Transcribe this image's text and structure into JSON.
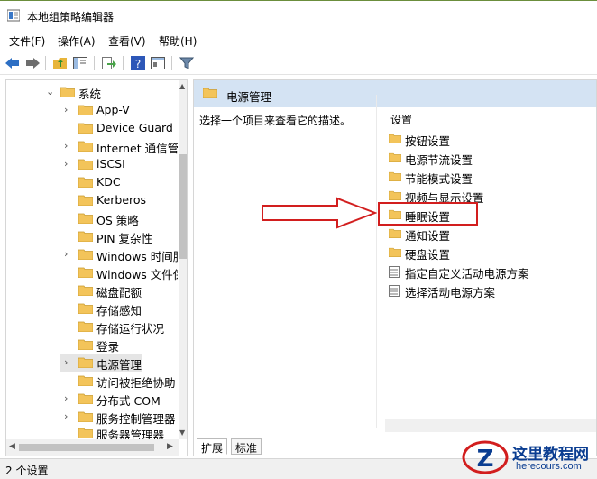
{
  "window": {
    "title": "本地组策略编辑器"
  },
  "menu": [
    "文件(F)",
    "操作(A)",
    "查看(V)",
    "帮助(H)"
  ],
  "toolbar": {
    "icons": [
      "back-icon",
      "forward-icon",
      "up-folder-icon",
      "show-hide-tree-icon",
      "export-list-icon",
      "help-icon",
      "properties-view-icon",
      "filter-icon"
    ]
  },
  "tree": {
    "items": [
      {
        "label": "系统",
        "expanded": true,
        "level": 1
      },
      {
        "label": "App-V",
        "level": 2
      },
      {
        "label": "Device Guard",
        "level": 2
      },
      {
        "label": "Internet 通信管",
        "level": 2
      },
      {
        "label": "iSCSI",
        "level": 2
      },
      {
        "label": "KDC",
        "level": 2
      },
      {
        "label": "Kerberos",
        "level": 2
      },
      {
        "label": "OS 策略",
        "level": 2
      },
      {
        "label": "PIN 复杂性",
        "level": 2
      },
      {
        "label": "Windows 时间服",
        "level": 2
      },
      {
        "label": "Windows 文件保",
        "level": 2
      },
      {
        "label": "磁盘配额",
        "level": 2
      },
      {
        "label": "存储感知",
        "level": 2
      },
      {
        "label": "存储运行状况",
        "level": 2
      },
      {
        "label": "登录",
        "level": 2
      },
      {
        "label": "电源管理",
        "level": 2,
        "selected": true
      },
      {
        "label": "访问被拒绝协助",
        "level": 2
      },
      {
        "label": "分布式 COM",
        "level": 2
      },
      {
        "label": "服务控制管理器",
        "level": 2
      },
      {
        "label": "服务器管理器",
        "level": 2
      }
    ]
  },
  "right_pane": {
    "header": "电源管理",
    "description": "选择一个项目来查看它的描述。",
    "settings_header": "设置",
    "settings": [
      {
        "label": "按钮设置",
        "type": "folder"
      },
      {
        "label": "电源节流设置",
        "type": "folder"
      },
      {
        "label": "节能模式设置",
        "type": "folder"
      },
      {
        "label": "视频与显示设置",
        "type": "folder"
      },
      {
        "label": "睡眠设置",
        "type": "folder",
        "highlighted": true
      },
      {
        "label": "通知设置",
        "type": "folder"
      },
      {
        "label": "硬盘设置",
        "type": "folder"
      },
      {
        "label": "指定自定义活动电源方案",
        "type": "policy"
      },
      {
        "label": "选择活动电源方案",
        "type": "policy"
      }
    ]
  },
  "tabs": [
    "扩展",
    "标准"
  ],
  "status": {
    "text": "2 个设置"
  },
  "watermark": {
    "brand": "这里教程网",
    "url": "herecours.com"
  },
  "colors": {
    "header_bg": "#d4e3f3",
    "folder": "#f3c45a",
    "annotation": "#d21e1e",
    "selected_row": "#e5e5e5",
    "brand": "#0a3d91"
  }
}
